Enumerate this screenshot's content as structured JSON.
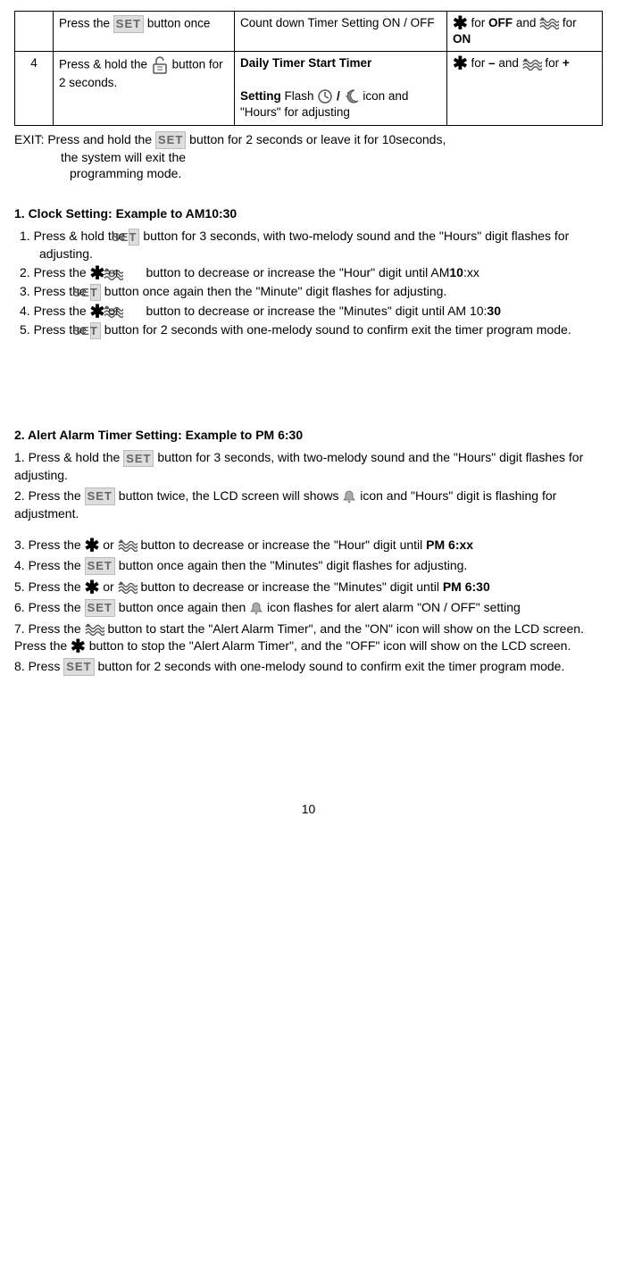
{
  "icons": {
    "set": "SET",
    "star": "✱"
  },
  "table": {
    "row1": {
      "col1": "",
      "col2_a": "Press the ",
      "col2_b": " button once",
      "col3": "Count down Timer Setting ON / OFF",
      "col4_a": " for ",
      "col4_off": "OFF",
      "col4_b": " and ",
      "col4_c": " for ",
      "col4_on": "ON"
    },
    "row2": {
      "col1": "4",
      "col2_a": "Press & hold the ",
      "col2_b": " button for 2 seconds.",
      "col3_title": "Daily Timer Start Timer",
      "col3_a": "Setting",
      "col3_b": " Flash ",
      "col3_c": " / ",
      "col3_d": " icon and \"Hours\" for adjusting",
      "col4_a": " for ",
      "col4_minus": "–",
      "col4_b": " and ",
      "col4_c": " for ",
      "col4_plus": "+"
    }
  },
  "exit": {
    "a": "EXIT: Press and hold the ",
    "b": " button for 2 seconds or leave it for 10seconds,",
    "c": "the system will exit the",
    "d": "programming mode."
  },
  "sec1": {
    "title": "1. Clock Setting: Example to AM10:30",
    "s1a": "1.  Press & hold the ",
    "s1b": " button for 3 seconds, with two-melody sound and the \"Hours\" digit flashes for adjusting.",
    "s2a": "2.  Press the ",
    "s2b": " or ",
    "s2c": " button to decrease or increase the \"Hour\" digit until AM",
    "s2d": "10",
    "s2e": ":xx",
    "s3a": "3. Press the ",
    "s3b": " button once again then the \"Minute\" digit flashes for adjusting.",
    "s4a": "4. Press the ",
    "s4b": " or ",
    "s4c": " button to decrease or increase the \"Minutes\" digit until AM 10:",
    "s4d": "30",
    "s5a": "5.    Press the ",
    "s5b": " button for 2 seconds with one-melody sound to confirm exit the timer program mode."
  },
  "sec2": {
    "title": "2. Alert Alarm Timer Setting: Example to PM 6:30",
    "s1a": "1. Press & hold the ",
    "s1b": " button for 3 seconds, with two-melody sound and the \"Hours\" digit flashes for adjusting.",
    "s2a": "2. Press the ",
    "s2b": " button twice, the LCD screen will shows ",
    "s2c": " icon and \"Hours\" digit is flashing for adjustment.",
    "s3a": "3. Press the ",
    "s3b": " or ",
    "s3c": " button to decrease or increase the \"Hour\" digit until ",
    "s3d": "PM 6:xx",
    "s4a": "4. Press the ",
    "s4b": " button once again then the \"Minutes\" digit flashes for adjusting.",
    "s5a": "5. Press the ",
    "s5b": " or ",
    "s5c": " button to decrease or increase the \"Minutes\" digit until ",
    "s5d": "PM 6:30",
    "s6a": "6. Press the ",
    "s6b": " button once again then ",
    "s6c": " icon flashes for alert alarm \"ON / OFF\" setting",
    "s7a": "7. Press the ",
    "s7b": " button to start the \"Alert Alarm Timer\", and the \"ON\" icon will show on the LCD screen. Press the ",
    "s7c": " button to stop the \"Alert Alarm Timer\", and the \"OFF\" icon will show on the LCD screen.",
    "s8a": "8. Press ",
    "s8b": " button for 2 seconds with one-melody sound to confirm exit the timer program mode."
  },
  "page": "10"
}
